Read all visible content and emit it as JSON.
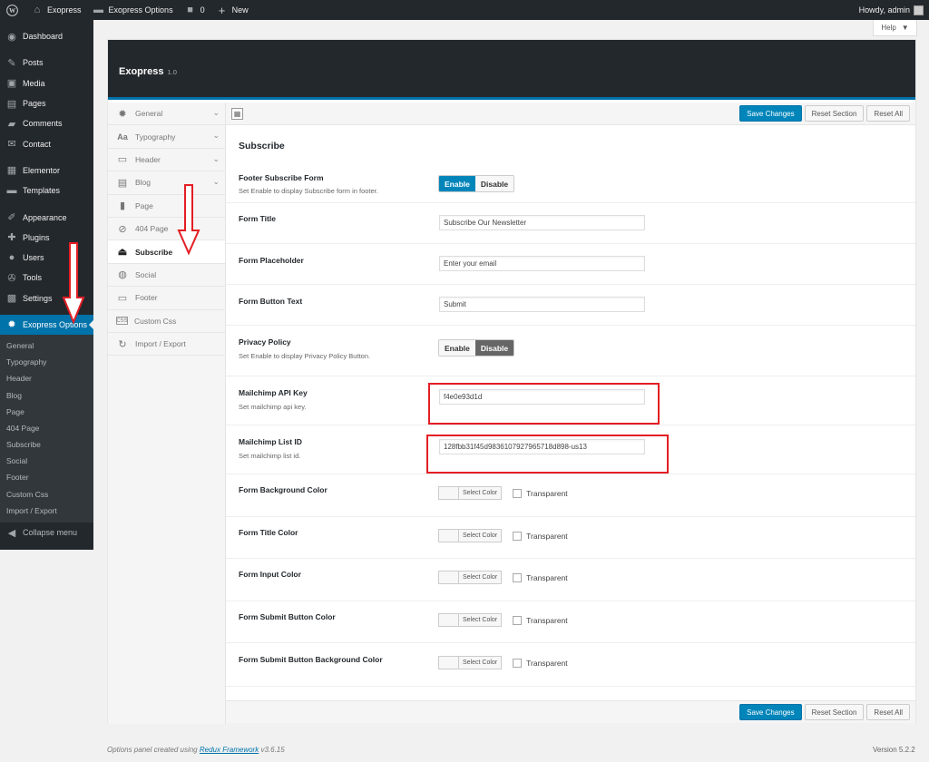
{
  "adminbar": {
    "site_name": "Exopress",
    "options_link": "Exopress Options",
    "comments_count": "0",
    "new_label": "New",
    "greeting": "Howdy, admin"
  },
  "help_label": "Help",
  "adminmenu": {
    "items": [
      {
        "label": "Dashboard",
        "icon": "dashboard-icon"
      },
      {
        "label": "Posts",
        "icon": "pin-icon"
      },
      {
        "label": "Media",
        "icon": "media-icon"
      },
      {
        "label": "Pages",
        "icon": "pages-icon"
      },
      {
        "label": "Comments",
        "icon": "comments-icon"
      },
      {
        "label": "Contact",
        "icon": "mail-icon"
      },
      {
        "label": "Elementor",
        "icon": "elementor-icon"
      },
      {
        "label": "Templates",
        "icon": "folder-icon"
      },
      {
        "label": "Appearance",
        "icon": "brush-icon"
      },
      {
        "label": "Plugins",
        "icon": "plug-icon"
      },
      {
        "label": "Users",
        "icon": "users-icon"
      },
      {
        "label": "Tools",
        "icon": "wrench-icon"
      },
      {
        "label": "Settings",
        "icon": "settings-icon"
      }
    ],
    "current": "Exopress Options",
    "submenu": [
      "General",
      "Typography",
      "Header",
      "Blog",
      "Page",
      "404 Page",
      "Subscribe",
      "Social",
      "Footer",
      "Custom Css",
      "Import / Export"
    ],
    "collapse": "Collapse menu"
  },
  "panel": {
    "title": "Exopress",
    "version": "1.0"
  },
  "sidenav": [
    {
      "label": "General",
      "icon": "gear-icon",
      "chevron": true
    },
    {
      "label": "Typography",
      "icon": "typography-icon",
      "chevron": true
    },
    {
      "label": "Header",
      "icon": "header-icon",
      "chevron": true
    },
    {
      "label": "Blog",
      "icon": "blog-icon",
      "chevron": true
    },
    {
      "label": "Page",
      "icon": "page-icon",
      "chevron": false
    },
    {
      "label": "404 Page",
      "icon": "ban-icon",
      "chevron": false
    },
    {
      "label": "Subscribe",
      "icon": "eject-icon",
      "chevron": false,
      "active": true
    },
    {
      "label": "Social",
      "icon": "globe-icon",
      "chevron": false
    },
    {
      "label": "Footer",
      "icon": "footer-icon",
      "chevron": false
    },
    {
      "label": "Custom Css",
      "icon": "css-icon",
      "chevron": false
    },
    {
      "label": "Import / Export",
      "icon": "refresh-icon",
      "chevron": false
    }
  ],
  "buttons": {
    "save": "Save Changes",
    "reset_section": "Reset Section",
    "reset_all": "Reset All"
  },
  "section_title": "Subscribe",
  "fields": {
    "footer_subscribe": {
      "label": "Footer Subscribe Form",
      "desc": "Set Enable to display Subscribe form in footer.",
      "on": "Enable",
      "off": "Disable"
    },
    "form_title": {
      "label": "Form Title",
      "value": "Subscribe Our Newsletter"
    },
    "form_placeholder": {
      "label": "Form Placeholder",
      "value": "Enter your email"
    },
    "form_button_text": {
      "label": "Form Button Text",
      "value": "Submit"
    },
    "privacy_policy": {
      "label": "Privacy Policy",
      "desc": "Set Enable to display Privacy Policy Button.",
      "on": "Enable",
      "off": "Disable"
    },
    "api_key": {
      "label": "Mailchimp API Key",
      "desc": "Set mailchimp api key.",
      "value": "f4e0e93d1d"
    },
    "list_id": {
      "label": "Mailchimp List ID",
      "desc": "Set mailchimp list id.",
      "value": "128fbb31f45d9836107927965718d898-us13"
    },
    "colors": [
      {
        "label": "Form Background Color"
      },
      {
        "label": "Form Title Color"
      },
      {
        "label": "Form Input Color"
      },
      {
        "label": "Form Submit Button Color"
      },
      {
        "label": "Form Submit Button Background Color"
      }
    ],
    "select_color": "Select Color",
    "transparent": "Transparent"
  },
  "footer": {
    "credit_prefix": "Options panel created using",
    "credit_link": "Redux Framework",
    "credit_version": "v3.6.15",
    "wp_version": "Version 5.2.2"
  },
  "annotation_color": "#e31e24",
  "accent_color": "#0073aa"
}
